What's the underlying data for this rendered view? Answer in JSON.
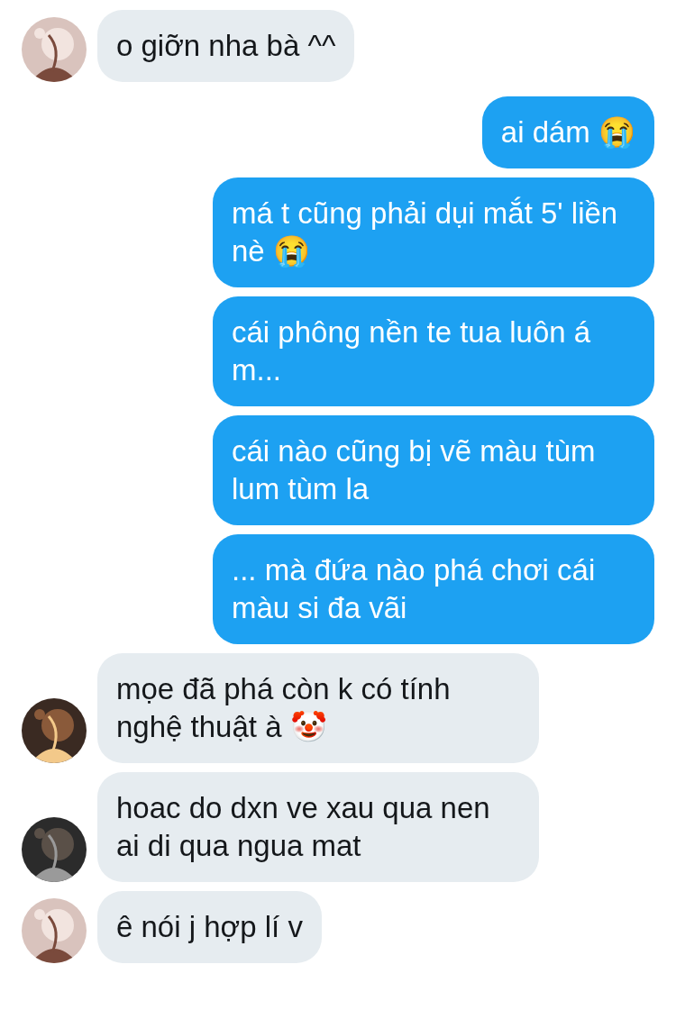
{
  "messages": [
    {
      "kind": "incoming",
      "text": "o giỡn nha bà ^^"
    },
    {
      "kind": "outgoing",
      "text": "ai dám 😭"
    },
    {
      "kind": "outgoing",
      "text": "má t cũng phải dụi mắt 5' liền nè 😭"
    },
    {
      "kind": "outgoing",
      "text": "cái phông nền te tua luôn á m..."
    },
    {
      "kind": "outgoing",
      "text": "cái nào cũng bị vẽ màu tùm lum tùm la"
    },
    {
      "kind": "outgoing",
      "text": "... mà đứa nào phá chơi cái màu si đa vãi"
    },
    {
      "kind": "incoming",
      "text": "mọe đã phá còn k có tính nghệ thuật à 🤡"
    },
    {
      "kind": "incoming",
      "text": "hoac do dxn ve xau qua nen ai di qua ngua mat"
    },
    {
      "kind": "incoming",
      "text": "ê nói j hợp lí v"
    }
  ]
}
